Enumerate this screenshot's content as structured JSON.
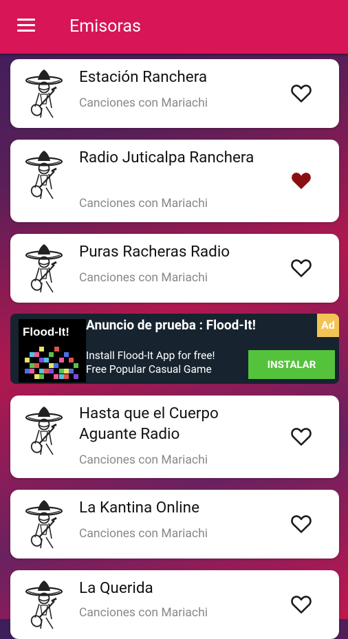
{
  "appbar": {
    "title": "Emisoras",
    "menu_icon": "hamburger-menu-icon"
  },
  "stations": [
    {
      "name": "Estación Ranchera",
      "subtitle": "Canciones con Mariachi",
      "favorite": false
    },
    {
      "name": "Radio Juticalpa Ranchera",
      "subtitle": "Canciones con Mariachi",
      "favorite": true
    },
    {
      "name": "Puras Racheras Radio",
      "subtitle": "Canciones con Mariachi",
      "favorite": false
    },
    {
      "name": "Hasta que el Cuerpo Aguante Radio",
      "subtitle": "Canciones con Mariachi",
      "favorite": false
    },
    {
      "name": "La Kantina Online",
      "subtitle": "Canciones con Mariachi",
      "favorite": false
    },
    {
      "name": "La Querida",
      "subtitle": "Canciones con Mariachi",
      "favorite": false
    }
  ],
  "ad": {
    "logo_text": "Flood-It!",
    "title": "Anuncio de prueba : Flood-It!",
    "badge": "Ad",
    "line1": "Install Flood-It App for free!",
    "line2": "Free Popular Casual Game",
    "cta": "INSTALAR"
  },
  "colors": {
    "appbar": "#d81557",
    "favorite_heart": "#8b0f12",
    "ad_background": "#17232f",
    "ad_cta": "#55c23c",
    "ad_badge": "#f3c454"
  }
}
